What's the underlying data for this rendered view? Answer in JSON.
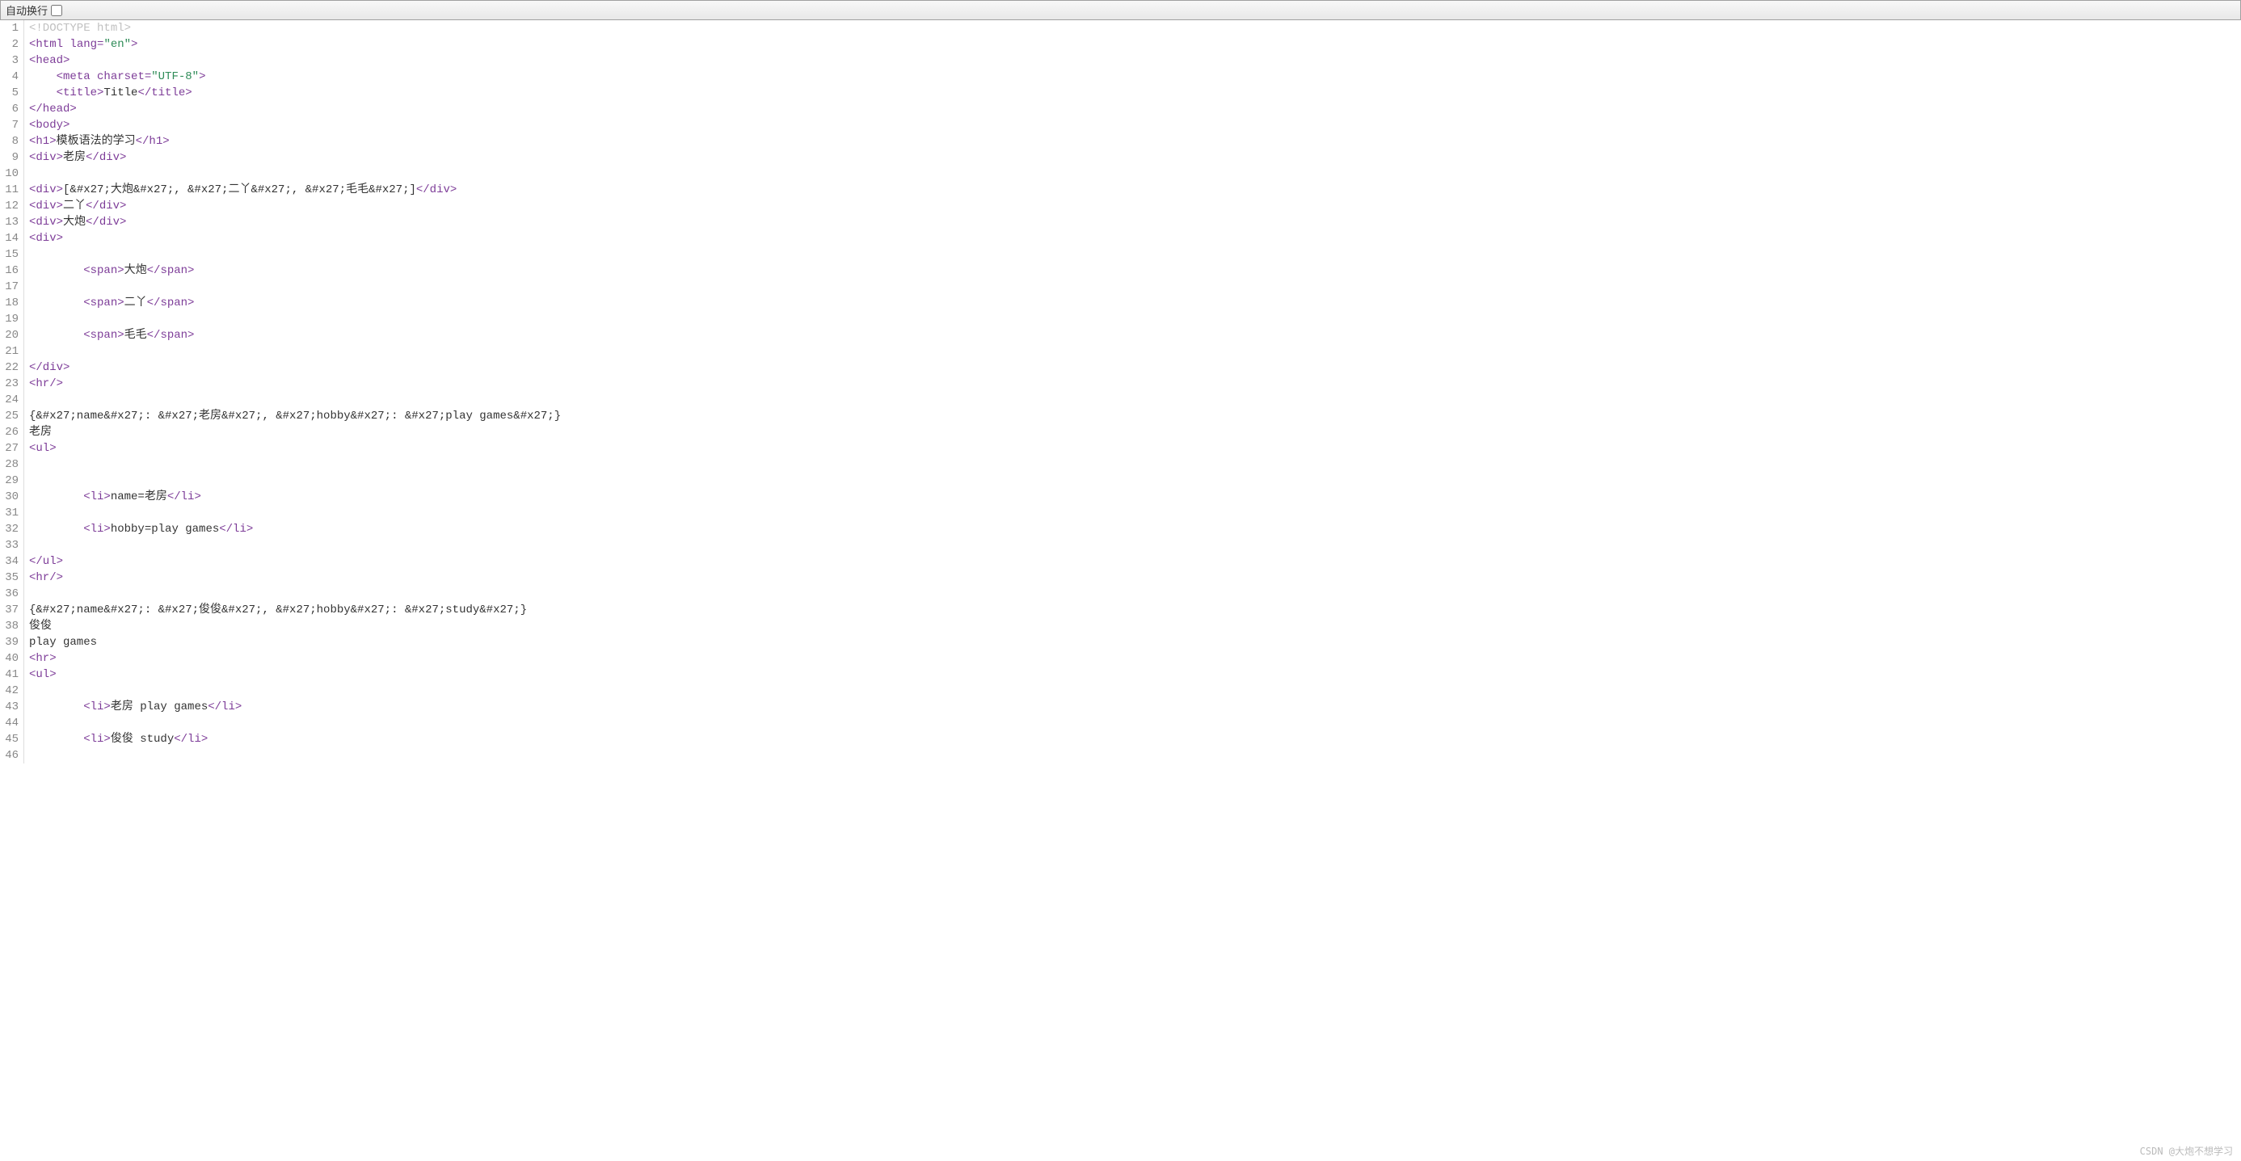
{
  "toolbar": {
    "wrap_label": "自动换行"
  },
  "watermark": "CSDN @大炮不想学习",
  "code": {
    "total_lines": 46,
    "lines": [
      {
        "segments": [
          {
            "cls": "doctype",
            "text": "<!DOCTYPE html>"
          }
        ]
      },
      {
        "segments": [
          {
            "cls": "tag",
            "text": "<html "
          },
          {
            "cls": "attr-name",
            "text": "lang="
          },
          {
            "cls": "attr-val",
            "text": "\"en\""
          },
          {
            "cls": "tag",
            "text": ">"
          }
        ]
      },
      {
        "segments": [
          {
            "cls": "tag",
            "text": "<head>"
          }
        ]
      },
      {
        "segments": [
          {
            "cls": "txt",
            "text": "    "
          },
          {
            "cls": "tag",
            "text": "<meta "
          },
          {
            "cls": "attr-name",
            "text": "charset="
          },
          {
            "cls": "attr-val",
            "text": "\"UTF-8\""
          },
          {
            "cls": "tag",
            "text": ">"
          }
        ]
      },
      {
        "segments": [
          {
            "cls": "txt",
            "text": "    "
          },
          {
            "cls": "tag",
            "text": "<title>"
          },
          {
            "cls": "txt",
            "text": "Title"
          },
          {
            "cls": "tag",
            "text": "</title>"
          }
        ]
      },
      {
        "segments": [
          {
            "cls": "tag",
            "text": "</head>"
          }
        ]
      },
      {
        "segments": [
          {
            "cls": "tag",
            "text": "<body>"
          }
        ]
      },
      {
        "segments": [
          {
            "cls": "tag",
            "text": "<h1>"
          },
          {
            "cls": "txt",
            "text": "模板语法的学习"
          },
          {
            "cls": "tag",
            "text": "</h1>"
          }
        ]
      },
      {
        "segments": [
          {
            "cls": "tag",
            "text": "<div>"
          },
          {
            "cls": "txt",
            "text": "老房"
          },
          {
            "cls": "tag",
            "text": "</div>"
          }
        ]
      },
      {
        "segments": []
      },
      {
        "segments": [
          {
            "cls": "tag",
            "text": "<div>"
          },
          {
            "cls": "txt",
            "text": "[&#x27;大炮&#x27;, &#x27;二丫&#x27;, &#x27;毛毛&#x27;]"
          },
          {
            "cls": "tag",
            "text": "</div>"
          }
        ]
      },
      {
        "segments": [
          {
            "cls": "tag",
            "text": "<div>"
          },
          {
            "cls": "txt",
            "text": "二丫"
          },
          {
            "cls": "tag",
            "text": "</div>"
          }
        ]
      },
      {
        "segments": [
          {
            "cls": "tag",
            "text": "<div>"
          },
          {
            "cls": "txt",
            "text": "大炮"
          },
          {
            "cls": "tag",
            "text": "</div>"
          }
        ]
      },
      {
        "segments": [
          {
            "cls": "tag",
            "text": "<div>"
          }
        ]
      },
      {
        "segments": []
      },
      {
        "segments": [
          {
            "cls": "txt",
            "text": "        "
          },
          {
            "cls": "tag",
            "text": "<span>"
          },
          {
            "cls": "txt",
            "text": "大炮"
          },
          {
            "cls": "tag",
            "text": "</span>"
          }
        ]
      },
      {
        "segments": []
      },
      {
        "segments": [
          {
            "cls": "txt",
            "text": "        "
          },
          {
            "cls": "tag",
            "text": "<span>"
          },
          {
            "cls": "txt",
            "text": "二丫"
          },
          {
            "cls": "tag",
            "text": "</span>"
          }
        ]
      },
      {
        "segments": []
      },
      {
        "segments": [
          {
            "cls": "txt",
            "text": "        "
          },
          {
            "cls": "tag",
            "text": "<span>"
          },
          {
            "cls": "txt",
            "text": "毛毛"
          },
          {
            "cls": "tag",
            "text": "</span>"
          }
        ]
      },
      {
        "segments": []
      },
      {
        "segments": [
          {
            "cls": "tag",
            "text": "</div>"
          }
        ]
      },
      {
        "segments": [
          {
            "cls": "tag",
            "text": "<hr/>"
          }
        ]
      },
      {
        "segments": []
      },
      {
        "segments": [
          {
            "cls": "txt",
            "text": "{&#x27;name&#x27;: &#x27;老房&#x27;, &#x27;hobby&#x27;: &#x27;play games&#x27;}"
          }
        ]
      },
      {
        "segments": [
          {
            "cls": "txt",
            "text": "老房"
          }
        ]
      },
      {
        "segments": [
          {
            "cls": "tag",
            "text": "<ul>"
          }
        ]
      },
      {
        "segments": []
      },
      {
        "segments": []
      },
      {
        "segments": [
          {
            "cls": "txt",
            "text": "        "
          },
          {
            "cls": "tag",
            "text": "<li>"
          },
          {
            "cls": "txt",
            "text": "name=老房"
          },
          {
            "cls": "tag",
            "text": "</li>"
          }
        ]
      },
      {
        "segments": []
      },
      {
        "segments": [
          {
            "cls": "txt",
            "text": "        "
          },
          {
            "cls": "tag",
            "text": "<li>"
          },
          {
            "cls": "txt",
            "text": "hobby=play games"
          },
          {
            "cls": "tag",
            "text": "</li>"
          }
        ]
      },
      {
        "segments": []
      },
      {
        "segments": [
          {
            "cls": "tag",
            "text": "</ul>"
          }
        ]
      },
      {
        "segments": [
          {
            "cls": "tag",
            "text": "<hr/>"
          }
        ]
      },
      {
        "segments": []
      },
      {
        "segments": [
          {
            "cls": "txt",
            "text": "{&#x27;name&#x27;: &#x27;俊俊&#x27;, &#x27;hobby&#x27;: &#x27;study&#x27;}"
          }
        ]
      },
      {
        "segments": [
          {
            "cls": "txt",
            "text": "俊俊"
          }
        ]
      },
      {
        "segments": [
          {
            "cls": "txt",
            "text": "play games"
          }
        ]
      },
      {
        "segments": [
          {
            "cls": "tag",
            "text": "<hr>"
          }
        ]
      },
      {
        "segments": [
          {
            "cls": "tag",
            "text": "<ul>"
          }
        ]
      },
      {
        "segments": []
      },
      {
        "segments": [
          {
            "cls": "txt",
            "text": "        "
          },
          {
            "cls": "tag",
            "text": "<li>"
          },
          {
            "cls": "txt",
            "text": "老房 play games"
          },
          {
            "cls": "tag",
            "text": "</li>"
          }
        ]
      },
      {
        "segments": []
      },
      {
        "segments": [
          {
            "cls": "txt",
            "text": "        "
          },
          {
            "cls": "tag",
            "text": "<li>"
          },
          {
            "cls": "txt",
            "text": "俊俊 study"
          },
          {
            "cls": "tag",
            "text": "</li>"
          }
        ]
      }
    ]
  }
}
